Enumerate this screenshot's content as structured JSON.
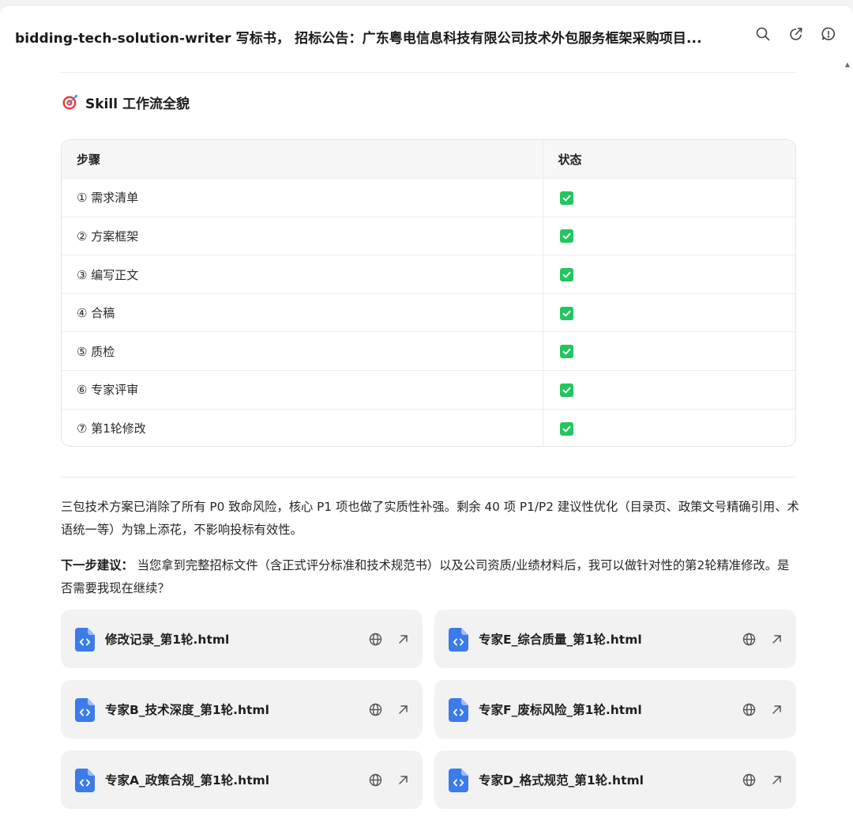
{
  "header": {
    "title": "bidding-tech-solution-writer 写标书， 招标公告：广东粤电信息科技有限公司技术外包服务框架采购项目...",
    "icons": [
      "search-icon",
      "share-icon",
      "feedback-icon"
    ]
  },
  "section": {
    "heading": "Skill 工作流全貌",
    "icon": "target-icon"
  },
  "table": {
    "headers": [
      "步骤",
      "状态"
    ],
    "rows": [
      {
        "step": "① 需求清单",
        "status": "done"
      },
      {
        "step": "② 方案框架",
        "status": "done"
      },
      {
        "step": "③ 编写正文",
        "status": "done"
      },
      {
        "step": "④ 合稿",
        "status": "done"
      },
      {
        "step": "⑤ 质检",
        "status": "done"
      },
      {
        "step": "⑥ 专家评审",
        "status": "done"
      },
      {
        "step": "⑦ 第1轮修改",
        "status": "done"
      }
    ],
    "check_color": "#22c55e"
  },
  "summary": {
    "text": "三包技术方案已消除了所有 P0 致命风险，核心 P1 项也做了实质性补强。剩余 40 项 P1/P2 建议性优化（目录页、政策文号精确引用、术语统一等）为锦上添花，不影响投标有效性。"
  },
  "next_step": {
    "label": "下一步建议：",
    "text": " 当您拿到完整招标文件（含正式评分标准和技术规范书）以及公司资质/业绩材料后，我可以做针对性的第2轮精准修改。是否需要我现在继续？"
  },
  "files": [
    {
      "name": "修改记录_第1轮.html"
    },
    {
      "name": "专家E_综合质量_第1轮.html"
    },
    {
      "name": "专家B_技术深度_第1轮.html"
    },
    {
      "name": "专家F_废标风险_第1轮.html"
    },
    {
      "name": "专家A_政策合规_第1轮.html"
    },
    {
      "name": "专家D_格式规范_第1轮.html"
    }
  ],
  "colors": {
    "file_icon": "#3b7bea",
    "card_bg": "#f2f2f2"
  }
}
